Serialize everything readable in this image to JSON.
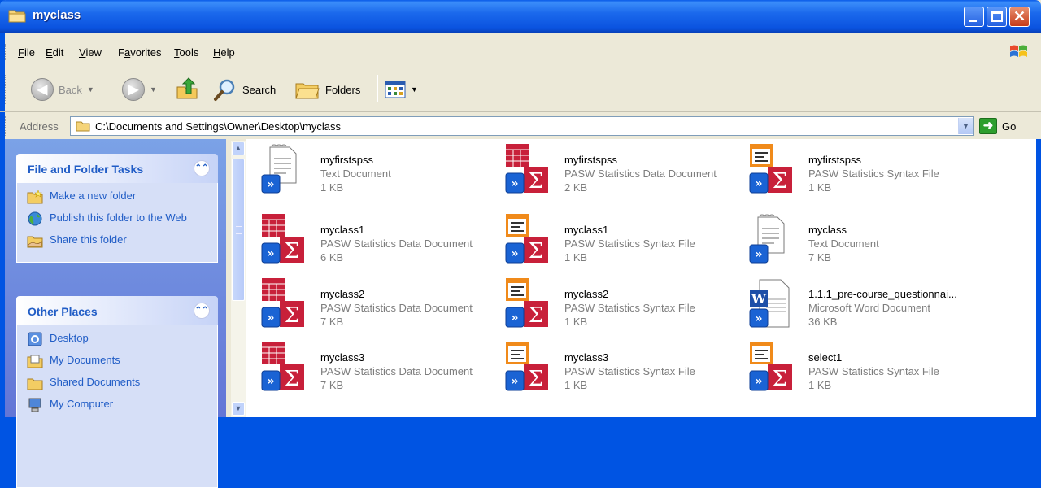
{
  "window": {
    "title": "myclass"
  },
  "menu": [
    "File",
    "Edit",
    "View",
    "Favorites",
    "Tools",
    "Help"
  ],
  "menu_mnemonics": [
    "F",
    "E",
    "V",
    "a",
    "T",
    "H"
  ],
  "toolbar": {
    "back": "Back",
    "search": "Search",
    "folders": "Folders"
  },
  "address": {
    "label": "Address",
    "path": "C:\\Documents and Settings\\Owner\\Desktop\\myclass",
    "go": "Go"
  },
  "tasks": {
    "title": "File and Folder Tasks",
    "items": [
      "Make a new folder",
      "Publish this folder to the Web",
      "Share this folder"
    ]
  },
  "other_places": {
    "title": "Other Places",
    "items": [
      "Desktop",
      "My Documents",
      "Shared Documents",
      "My Computer"
    ]
  },
  "files": [
    {
      "name": "myfirstspss",
      "type": "Text Document",
      "size": "1 KB",
      "icon": "text-doc"
    },
    {
      "name": "myfirstspss",
      "type": "PASW Statistics Data Document",
      "size": "2 KB",
      "icon": "spss-data"
    },
    {
      "name": "myfirstspss",
      "type": "PASW Statistics Syntax File",
      "size": "1 KB",
      "icon": "spss-syntax"
    },
    {
      "name": "myclass1",
      "type": "PASW Statistics Data Document",
      "size": "6 KB",
      "icon": "spss-data"
    },
    {
      "name": "myclass1",
      "type": "PASW Statistics Syntax File",
      "size": "1 KB",
      "icon": "spss-syntax"
    },
    {
      "name": "myclass",
      "type": "Text Document",
      "size": "7 KB",
      "icon": "text-doc"
    },
    {
      "name": "myclass2",
      "type": "PASW Statistics Data Document",
      "size": "7 KB",
      "icon": "spss-data"
    },
    {
      "name": "myclass2",
      "type": "PASW Statistics Syntax File",
      "size": "1 KB",
      "icon": "spss-syntax"
    },
    {
      "name": "1.1.1_pre-course_questionnai...",
      "type": "Microsoft Word Document",
      "size": "36 KB",
      "icon": "word-doc"
    },
    {
      "name": "myclass3",
      "type": "PASW Statistics Data Document",
      "size": "7 KB",
      "icon": "spss-data"
    },
    {
      "name": "myclass3",
      "type": "PASW Statistics Syntax File",
      "size": "1 KB",
      "icon": "spss-syntax"
    },
    {
      "name": "select1",
      "type": "PASW Statistics Syntax File",
      "size": "1 KB",
      "icon": "spss-syntax"
    }
  ],
  "colors": {
    "title_bar": "#0a52df",
    "task_pane": "#6375d6",
    "link": "#215dc6",
    "spss_red": "#c8203a",
    "shortcut_blue": "#1a63d4"
  }
}
